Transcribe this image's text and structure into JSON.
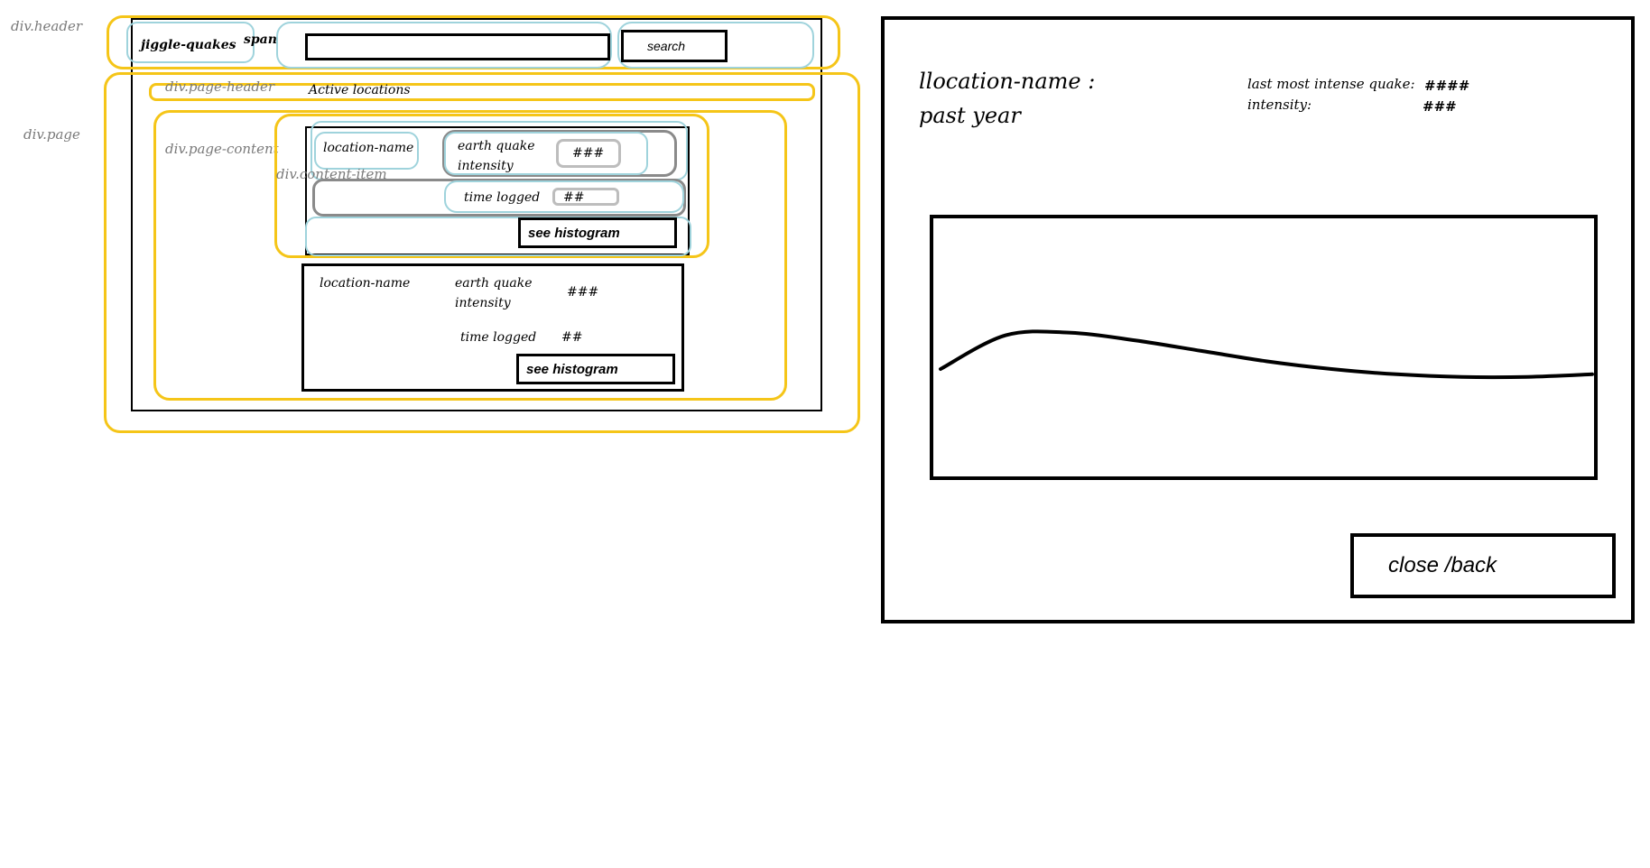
{
  "annotations": {
    "header": "div.header",
    "page": "div.page",
    "page_header": "div.page-header",
    "page_content": "div.page-content",
    "content_item": "div.content-item"
  },
  "header": {
    "logo": "jiggle-quakes",
    "span_label": "span",
    "search_value": "",
    "search_button": "search"
  },
  "page_header": {
    "title": "Active locations"
  },
  "items": [
    {
      "location": "location-name",
      "intensity_label_1": "earth quake",
      "intensity_label_2": "intensity",
      "intensity_value": "###",
      "time_label": "time logged",
      "time_value": "##",
      "histogram_button": "see histogram"
    },
    {
      "location": "location-name",
      "intensity_label_1": "earth quake",
      "intensity_label_2": "intensity",
      "intensity_value": "###",
      "time_label": "time logged",
      "time_value": "##",
      "histogram_button": "see histogram"
    }
  ],
  "detail": {
    "location_title": "llocation-name :",
    "period": "past year",
    "last_quake_label": "last most intense quake:",
    "last_quake_value": "####",
    "intensity_label": "intensity:",
    "intensity_value": "###",
    "close_button": "close /back"
  },
  "chart_data": {
    "type": "line",
    "title": "",
    "xlabel": "",
    "ylabel": "",
    "grid": false,
    "x": [
      0,
      0.1,
      0.2,
      0.3,
      0.4,
      0.5,
      0.6,
      0.7,
      0.8,
      0.9,
      1.0
    ],
    "series": [
      {
        "values": [
          0.42,
          0.55,
          0.56,
          0.53,
          0.49,
          0.45,
          0.42,
          0.4,
          0.39,
          0.39,
          0.4
        ]
      }
    ],
    "xlim": [
      0,
      1
    ],
    "ylim": [
      0,
      1
    ]
  }
}
